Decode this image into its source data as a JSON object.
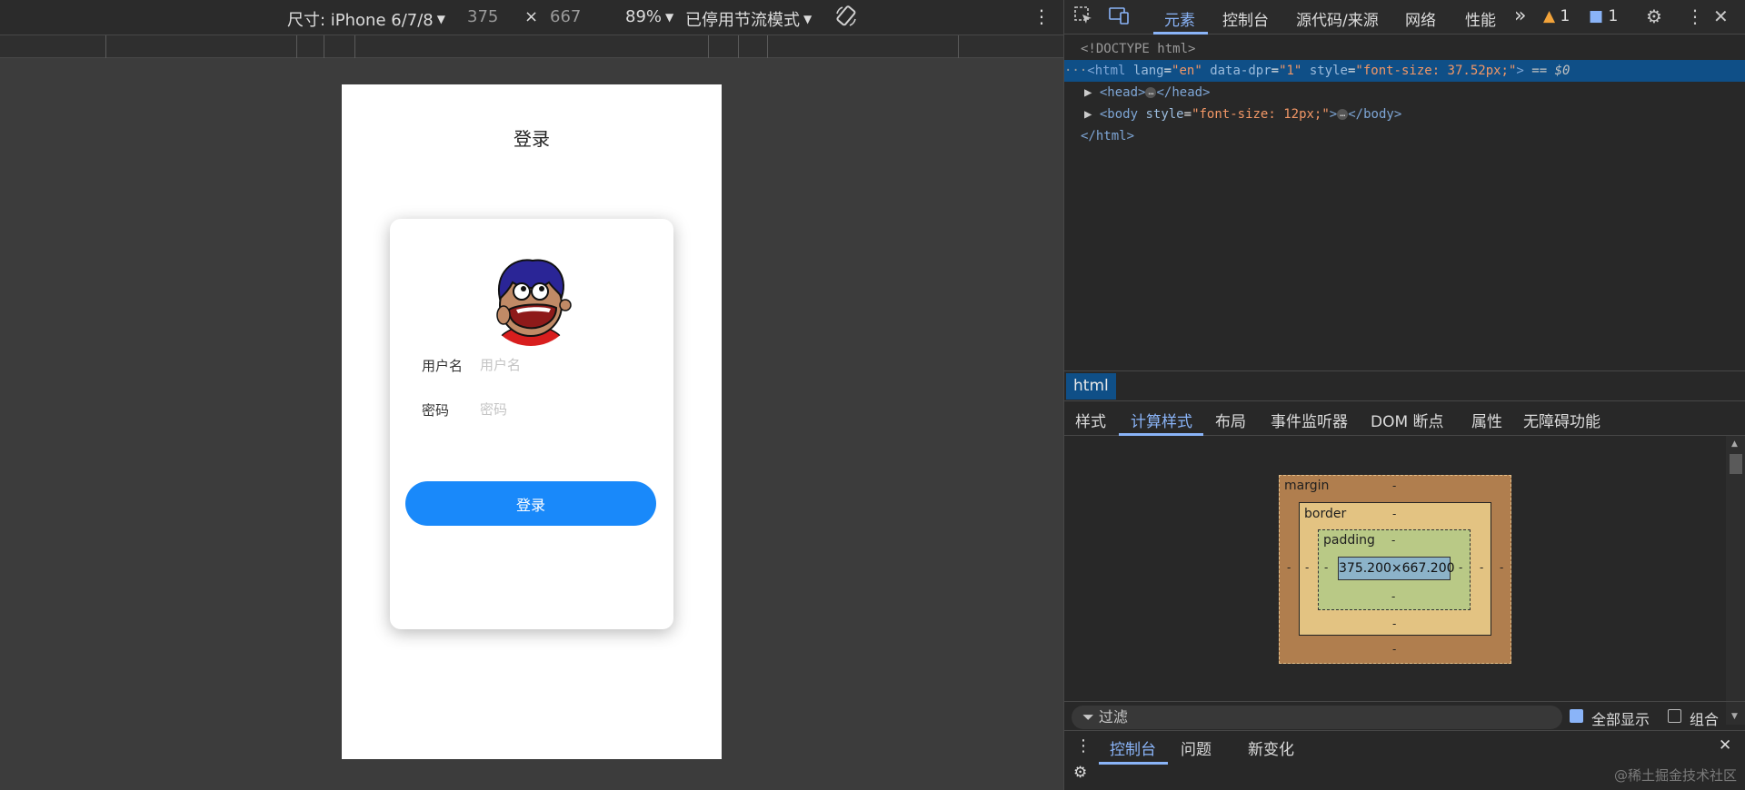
{
  "device_toolbar": {
    "dimensions_label": "尺寸: iPhone 6/7/8",
    "width": "375",
    "times": "×",
    "height": "667",
    "zoom": "89%",
    "throttle": "已停用节流模式"
  },
  "phone": {
    "nav_title": "登录",
    "username_label": "用户名",
    "username_placeholder": "用户名",
    "password_label": "密码",
    "password_placeholder": "密码",
    "login_button": "登录"
  },
  "devtools": {
    "tabs": [
      "元素",
      "控制台",
      "源代码/来源",
      "网络",
      "性能"
    ],
    "more": "»",
    "warning_count": "1",
    "message_count": "1",
    "dom": {
      "doctype": "<!DOCTYPE html>",
      "html_open": "<html",
      "lang_attr": "lang",
      "lang_val": "\"en\"",
      "dpr_attr": "data-dpr",
      "dpr_val": "\"1\"",
      "style_attr": "style",
      "html_style_val": "\"font-size: 37.52px;\"",
      "html_close_bracket": ">",
      "selected_marker": "== $0",
      "head_open": "<head>",
      "head_close": "</head>",
      "body_open": "<body",
      "body_style_val": "\"font-size: 12px;\"",
      "body_close": "</body>",
      "html_close": "</html>",
      "ellipsis": "…"
    },
    "breadcrumb": "html",
    "sub_tabs": [
      "样式",
      "计算样式",
      "布局",
      "事件监听器",
      "DOM 断点",
      "属性",
      "无障碍功能"
    ],
    "box_model": {
      "margin_label": "margin",
      "border_label": "border",
      "padding_label": "padding",
      "content_size": "375.200×667.200",
      "dash": "-"
    },
    "filter_placeholder": "过滤",
    "show_all": "全部显示",
    "group": "组合",
    "drawer_tabs": [
      "控制台",
      "问题",
      "新变化"
    ],
    "watermark": "@稀土掘金技术社区"
  }
}
